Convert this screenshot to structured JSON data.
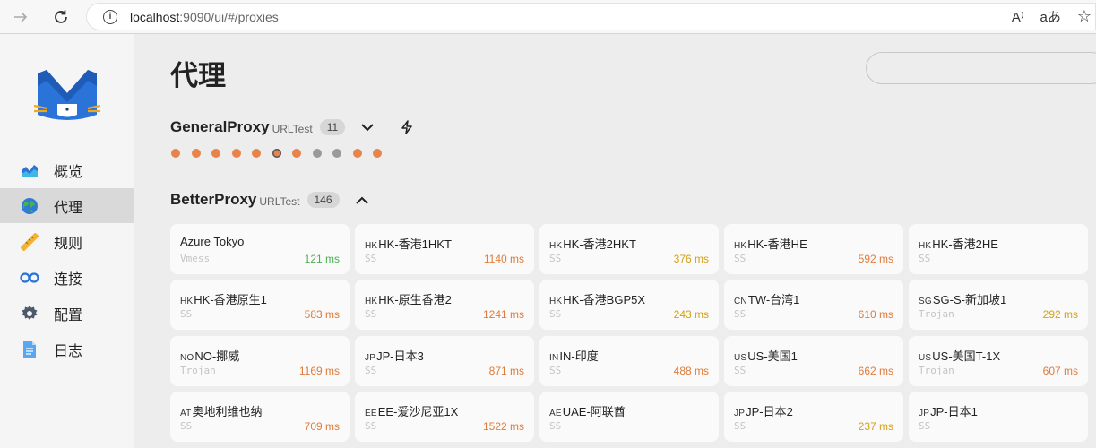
{
  "browser": {
    "url_host": "localhost",
    "url_rest": ":9090/ui/#/proxies",
    "read_aloud": "A⁾",
    "immersive": "aあ",
    "favorite": "☆"
  },
  "sidebar": {
    "items": [
      {
        "label": "概览",
        "icon": "overview-chart-icon"
      },
      {
        "label": "代理",
        "icon": "globe-icon"
      },
      {
        "label": "规则",
        "icon": "ruler-icon"
      },
      {
        "label": "连接",
        "icon": "link-icon"
      },
      {
        "label": "配置",
        "icon": "gear-icon"
      },
      {
        "label": "日志",
        "icon": "document-icon"
      }
    ],
    "active_index": 1
  },
  "page": {
    "title": "代理",
    "search_placeholder": ""
  },
  "groups": [
    {
      "name": "GeneralProxy",
      "type": "URLTest",
      "count": "11",
      "expanded": false
    },
    {
      "name": "BetterProxy",
      "type": "URLTest",
      "count": "146",
      "expanded": true
    }
  ],
  "general_dots": [
    "#e8834a",
    "#e8834a",
    "#e8834a",
    "#e8834a",
    "#e8834a",
    "#e8834a",
    "#e8834a",
    "#9a9a9a",
    "#9a9a9a",
    "#e8834a",
    "#e8834a"
  ],
  "general_selected_dot": 5,
  "colors": {
    "fast": "#4caf50",
    "medium": "#d4a017",
    "slow": "#e07b39",
    "accent": "#e8834a"
  },
  "proxies": [
    {
      "flag": "",
      "name": "Azure Tokyo",
      "type": "Vmess",
      "latency": "121 ms",
      "speed": "fast"
    },
    {
      "flag": "HK",
      "name": "HK-香港1HKT",
      "type": "SS",
      "latency": "1140 ms",
      "speed": "slow"
    },
    {
      "flag": "HK",
      "name": "HK-香港2HKT",
      "type": "SS",
      "latency": "376 ms",
      "speed": "medium"
    },
    {
      "flag": "HK",
      "name": "HK-香港HE",
      "type": "SS",
      "latency": "592 ms",
      "speed": "slow"
    },
    {
      "flag": "HK",
      "name": "HK-香港2HE",
      "type": "SS",
      "latency": "",
      "speed": "none"
    },
    {
      "flag": "HK",
      "name": "HK-香港原生1",
      "type": "SS",
      "latency": "583 ms",
      "speed": "slow"
    },
    {
      "flag": "HK",
      "name": "HK-原生香港2",
      "type": "SS",
      "latency": "1241 ms",
      "speed": "slow"
    },
    {
      "flag": "HK",
      "name": "HK-香港BGP5X",
      "type": "SS",
      "latency": "243 ms",
      "speed": "medium"
    },
    {
      "flag": "CN",
      "name": "TW-台湾1",
      "type": "SS",
      "latency": "610 ms",
      "speed": "slow"
    },
    {
      "flag": "SG",
      "name": "SG-S-新加坡1",
      "type": "Trojan",
      "latency": "292 ms",
      "speed": "medium"
    },
    {
      "flag": "NO",
      "name": "NO-挪威",
      "type": "Trojan",
      "latency": "1169 ms",
      "speed": "slow"
    },
    {
      "flag": "JP",
      "name": "JP-日本3",
      "type": "SS",
      "latency": "871 ms",
      "speed": "slow"
    },
    {
      "flag": "IN",
      "name": "IN-印度",
      "type": "SS",
      "latency": "488 ms",
      "speed": "slow"
    },
    {
      "flag": "US",
      "name": "US-美国1",
      "type": "SS",
      "latency": "662 ms",
      "speed": "slow"
    },
    {
      "flag": "US",
      "name": "US-美国T-1X",
      "type": "Trojan",
      "latency": "607 ms",
      "speed": "slow"
    },
    {
      "flag": "AT",
      "name": "奥地利维也纳",
      "type": "SS",
      "latency": "709 ms",
      "speed": "slow"
    },
    {
      "flag": "EE",
      "name": "EE-爱沙尼亚1X",
      "type": "SS",
      "latency": "1522 ms",
      "speed": "slow"
    },
    {
      "flag": "AE",
      "name": "UAE-阿联酋",
      "type": "SS",
      "latency": "",
      "speed": "none"
    },
    {
      "flag": "JP",
      "name": "JP-日本2",
      "type": "SS",
      "latency": "237 ms",
      "speed": "medium"
    },
    {
      "flag": "JP",
      "name": "JP-日本1",
      "type": "SS",
      "latency": "",
      "speed": "none"
    }
  ]
}
